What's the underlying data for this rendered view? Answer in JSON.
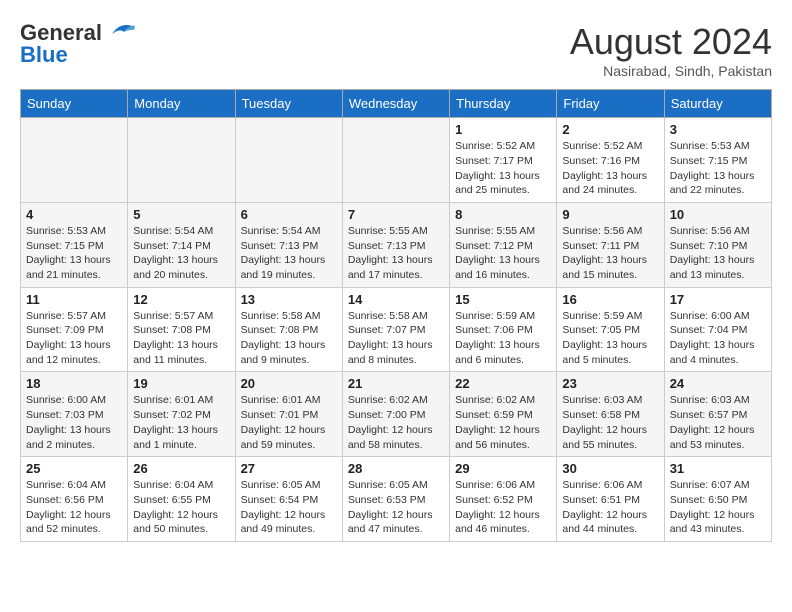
{
  "header": {
    "logo_line1": "General",
    "logo_line2": "Blue",
    "month": "August 2024",
    "location": "Nasirabad, Sindh, Pakistan"
  },
  "weekdays": [
    "Sunday",
    "Monday",
    "Tuesday",
    "Wednesday",
    "Thursday",
    "Friday",
    "Saturday"
  ],
  "weeks": [
    [
      {
        "day": "",
        "sunrise": "",
        "sunset": "",
        "daylight": "",
        "empty": true
      },
      {
        "day": "",
        "sunrise": "",
        "sunset": "",
        "daylight": "",
        "empty": true
      },
      {
        "day": "",
        "sunrise": "",
        "sunset": "",
        "daylight": "",
        "empty": true
      },
      {
        "day": "",
        "sunrise": "",
        "sunset": "",
        "daylight": "",
        "empty": true
      },
      {
        "day": "1",
        "sunrise": "Sunrise: 5:52 AM",
        "sunset": "Sunset: 7:17 PM",
        "daylight": "Daylight: 13 hours and 25 minutes.",
        "empty": false
      },
      {
        "day": "2",
        "sunrise": "Sunrise: 5:52 AM",
        "sunset": "Sunset: 7:16 PM",
        "daylight": "Daylight: 13 hours and 24 minutes.",
        "empty": false
      },
      {
        "day": "3",
        "sunrise": "Sunrise: 5:53 AM",
        "sunset": "Sunset: 7:15 PM",
        "daylight": "Daylight: 13 hours and 22 minutes.",
        "empty": false
      }
    ],
    [
      {
        "day": "4",
        "sunrise": "Sunrise: 5:53 AM",
        "sunset": "Sunset: 7:15 PM",
        "daylight": "Daylight: 13 hours and 21 minutes.",
        "empty": false
      },
      {
        "day": "5",
        "sunrise": "Sunrise: 5:54 AM",
        "sunset": "Sunset: 7:14 PM",
        "daylight": "Daylight: 13 hours and 20 minutes.",
        "empty": false
      },
      {
        "day": "6",
        "sunrise": "Sunrise: 5:54 AM",
        "sunset": "Sunset: 7:13 PM",
        "daylight": "Daylight: 13 hours and 19 minutes.",
        "empty": false
      },
      {
        "day": "7",
        "sunrise": "Sunrise: 5:55 AM",
        "sunset": "Sunset: 7:13 PM",
        "daylight": "Daylight: 13 hours and 17 minutes.",
        "empty": false
      },
      {
        "day": "8",
        "sunrise": "Sunrise: 5:55 AM",
        "sunset": "Sunset: 7:12 PM",
        "daylight": "Daylight: 13 hours and 16 minutes.",
        "empty": false
      },
      {
        "day": "9",
        "sunrise": "Sunrise: 5:56 AM",
        "sunset": "Sunset: 7:11 PM",
        "daylight": "Daylight: 13 hours and 15 minutes.",
        "empty": false
      },
      {
        "day": "10",
        "sunrise": "Sunrise: 5:56 AM",
        "sunset": "Sunset: 7:10 PM",
        "daylight": "Daylight: 13 hours and 13 minutes.",
        "empty": false
      }
    ],
    [
      {
        "day": "11",
        "sunrise": "Sunrise: 5:57 AM",
        "sunset": "Sunset: 7:09 PM",
        "daylight": "Daylight: 13 hours and 12 minutes.",
        "empty": false
      },
      {
        "day": "12",
        "sunrise": "Sunrise: 5:57 AM",
        "sunset": "Sunset: 7:08 PM",
        "daylight": "Daylight: 13 hours and 11 minutes.",
        "empty": false
      },
      {
        "day": "13",
        "sunrise": "Sunrise: 5:58 AM",
        "sunset": "Sunset: 7:08 PM",
        "daylight": "Daylight: 13 hours and 9 minutes.",
        "empty": false
      },
      {
        "day": "14",
        "sunrise": "Sunrise: 5:58 AM",
        "sunset": "Sunset: 7:07 PM",
        "daylight": "Daylight: 13 hours and 8 minutes.",
        "empty": false
      },
      {
        "day": "15",
        "sunrise": "Sunrise: 5:59 AM",
        "sunset": "Sunset: 7:06 PM",
        "daylight": "Daylight: 13 hours and 6 minutes.",
        "empty": false
      },
      {
        "day": "16",
        "sunrise": "Sunrise: 5:59 AM",
        "sunset": "Sunset: 7:05 PM",
        "daylight": "Daylight: 13 hours and 5 minutes.",
        "empty": false
      },
      {
        "day": "17",
        "sunrise": "Sunrise: 6:00 AM",
        "sunset": "Sunset: 7:04 PM",
        "daylight": "Daylight: 13 hours and 4 minutes.",
        "empty": false
      }
    ],
    [
      {
        "day": "18",
        "sunrise": "Sunrise: 6:00 AM",
        "sunset": "Sunset: 7:03 PM",
        "daylight": "Daylight: 13 hours and 2 minutes.",
        "empty": false
      },
      {
        "day": "19",
        "sunrise": "Sunrise: 6:01 AM",
        "sunset": "Sunset: 7:02 PM",
        "daylight": "Daylight: 13 hours and 1 minute.",
        "empty": false
      },
      {
        "day": "20",
        "sunrise": "Sunrise: 6:01 AM",
        "sunset": "Sunset: 7:01 PM",
        "daylight": "Daylight: 12 hours and 59 minutes.",
        "empty": false
      },
      {
        "day": "21",
        "sunrise": "Sunrise: 6:02 AM",
        "sunset": "Sunset: 7:00 PM",
        "daylight": "Daylight: 12 hours and 58 minutes.",
        "empty": false
      },
      {
        "day": "22",
        "sunrise": "Sunrise: 6:02 AM",
        "sunset": "Sunset: 6:59 PM",
        "daylight": "Daylight: 12 hours and 56 minutes.",
        "empty": false
      },
      {
        "day": "23",
        "sunrise": "Sunrise: 6:03 AM",
        "sunset": "Sunset: 6:58 PM",
        "daylight": "Daylight: 12 hours and 55 minutes.",
        "empty": false
      },
      {
        "day": "24",
        "sunrise": "Sunrise: 6:03 AM",
        "sunset": "Sunset: 6:57 PM",
        "daylight": "Daylight: 12 hours and 53 minutes.",
        "empty": false
      }
    ],
    [
      {
        "day": "25",
        "sunrise": "Sunrise: 6:04 AM",
        "sunset": "Sunset: 6:56 PM",
        "daylight": "Daylight: 12 hours and 52 minutes.",
        "empty": false
      },
      {
        "day": "26",
        "sunrise": "Sunrise: 6:04 AM",
        "sunset": "Sunset: 6:55 PM",
        "daylight": "Daylight: 12 hours and 50 minutes.",
        "empty": false
      },
      {
        "day": "27",
        "sunrise": "Sunrise: 6:05 AM",
        "sunset": "Sunset: 6:54 PM",
        "daylight": "Daylight: 12 hours and 49 minutes.",
        "empty": false
      },
      {
        "day": "28",
        "sunrise": "Sunrise: 6:05 AM",
        "sunset": "Sunset: 6:53 PM",
        "daylight": "Daylight: 12 hours and 47 minutes.",
        "empty": false
      },
      {
        "day": "29",
        "sunrise": "Sunrise: 6:06 AM",
        "sunset": "Sunset: 6:52 PM",
        "daylight": "Daylight: 12 hours and 46 minutes.",
        "empty": false
      },
      {
        "day": "30",
        "sunrise": "Sunrise: 6:06 AM",
        "sunset": "Sunset: 6:51 PM",
        "daylight": "Daylight: 12 hours and 44 minutes.",
        "empty": false
      },
      {
        "day": "31",
        "sunrise": "Sunrise: 6:07 AM",
        "sunset": "Sunset: 6:50 PM",
        "daylight": "Daylight: 12 hours and 43 minutes.",
        "empty": false
      }
    ]
  ]
}
